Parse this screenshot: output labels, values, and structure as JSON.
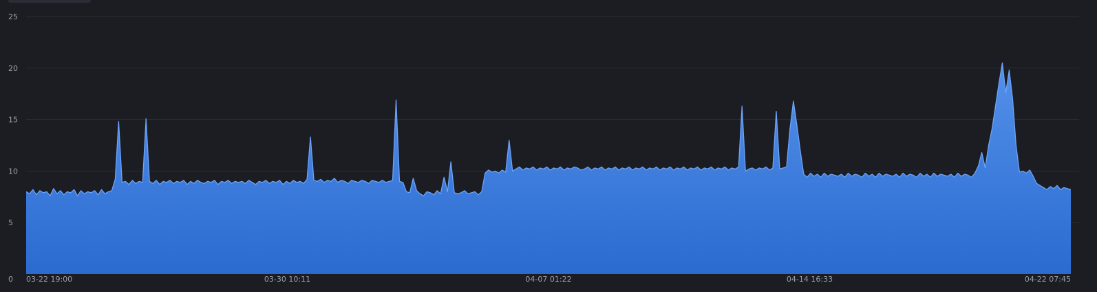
{
  "chart_data": {
    "type": "area",
    "title": "",
    "xlabel": "",
    "ylabel": "",
    "ylim": [
      0,
      25
    ],
    "yticks": [
      0,
      5,
      10,
      15,
      20,
      25
    ],
    "xticks": [
      "03-22 19:00",
      "03-30 10:11",
      "04-07 01:22",
      "04-14 16:33",
      "04-22 07:45"
    ],
    "grid": true,
    "legend": "none",
    "colors": {
      "background": "#1b1d23",
      "grid": "#2a2d35",
      "line": "#6ea3f7",
      "fill_top": "#5591ea",
      "fill_bottom": "#2a6bd0",
      "tick_text": "#9aa0aa"
    },
    "series": [
      {
        "values": [
          8.0,
          7.8,
          8.2,
          7.7,
          8.1,
          7.9,
          8.0,
          7.6,
          8.3,
          7.8,
          8.1,
          7.7,
          8.0,
          7.9,
          8.2,
          7.6,
          8.1,
          7.8,
          8.0,
          7.9,
          8.1,
          7.7,
          8.2,
          7.8,
          8.0,
          8.1,
          9.2,
          14.8,
          8.9,
          9.0,
          8.7,
          9.1,
          8.8,
          9.0,
          8.9,
          15.1,
          9.0,
          8.8,
          9.1,
          8.7,
          9.0,
          8.9,
          9.1,
          8.8,
          9.0,
          8.9,
          9.1,
          8.7,
          9.0,
          8.8,
          9.1,
          8.9,
          8.8,
          9.0,
          8.9,
          9.1,
          8.7,
          9.0,
          8.9,
          9.1,
          8.8,
          9.0,
          8.9,
          9.0,
          8.8,
          9.1,
          8.9,
          8.7,
          9.0,
          8.9,
          9.1,
          8.8,
          9.0,
          8.9,
          9.1,
          8.7,
          9.0,
          8.8,
          9.1,
          8.9,
          9.0,
          8.8,
          9.2,
          13.3,
          9.1,
          9.0,
          9.2,
          8.9,
          9.1,
          9.0,
          9.3,
          8.9,
          9.1,
          9.0,
          8.8,
          9.1,
          9.0,
          8.9,
          9.1,
          9.0,
          8.8,
          9.1,
          9.0,
          8.9,
          9.1,
          8.9,
          9.0,
          9.1,
          16.9,
          9.0,
          8.9,
          8.0,
          7.9,
          9.3,
          8.1,
          7.8,
          7.6,
          8.0,
          7.9,
          7.7,
          8.1,
          7.8,
          9.4,
          8.0,
          10.9,
          7.9,
          7.8,
          7.9,
          8.1,
          7.8,
          7.9,
          8.0,
          7.7,
          8.0,
          9.8,
          10.1,
          9.9,
          10.0,
          9.8,
          10.1,
          9.9,
          13.0,
          10.0,
          10.2,
          10.4,
          10.1,
          10.3,
          10.2,
          10.4,
          10.1,
          10.3,
          10.2,
          10.4,
          10.1,
          10.3,
          10.2,
          10.4,
          10.1,
          10.3,
          10.2,
          10.4,
          10.3,
          10.1,
          10.2,
          10.4,
          10.1,
          10.3,
          10.2,
          10.4,
          10.1,
          10.3,
          10.2,
          10.4,
          10.1,
          10.3,
          10.2,
          10.4,
          10.1,
          10.3,
          10.2,
          10.4,
          10.1,
          10.3,
          10.2,
          10.4,
          10.1,
          10.3,
          10.2,
          10.4,
          10.1,
          10.3,
          10.2,
          10.4,
          10.1,
          10.3,
          10.2,
          10.4,
          10.1,
          10.3,
          10.2,
          10.4,
          10.1,
          10.3,
          10.2,
          10.4,
          10.1,
          10.3,
          10.2,
          10.4,
          16.3,
          10.0,
          10.2,
          10.3,
          10.1,
          10.3,
          10.2,
          10.4,
          10.1,
          10.3,
          15.8,
          10.2,
          10.3,
          10.4,
          14.1,
          16.8,
          14.5,
          12.0,
          9.7,
          9.4,
          9.8,
          9.5,
          9.7,
          9.4,
          9.8,
          9.5,
          9.7,
          9.6,
          9.5,
          9.7,
          9.4,
          9.8,
          9.5,
          9.7,
          9.6,
          9.4,
          9.8,
          9.5,
          9.7,
          9.4,
          9.8,
          9.5,
          9.7,
          9.6,
          9.5,
          9.7,
          9.4,
          9.8,
          9.5,
          9.7,
          9.6,
          9.4,
          9.8,
          9.5,
          9.7,
          9.4,
          9.8,
          9.5,
          9.7,
          9.6,
          9.5,
          9.7,
          9.4,
          9.8,
          9.5,
          9.7,
          9.6,
          9.4,
          9.8,
          10.5,
          11.8,
          10.3,
          12.5,
          14.1,
          16.3,
          18.5,
          20.5,
          17.6,
          19.8,
          17.0,
          12.5,
          9.9,
          10.0,
          9.8,
          10.1,
          9.5,
          8.8,
          8.6,
          8.4,
          8.2,
          8.5,
          8.3,
          8.6,
          8.2,
          8.4,
          8.3,
          8.2
        ]
      }
    ]
  }
}
